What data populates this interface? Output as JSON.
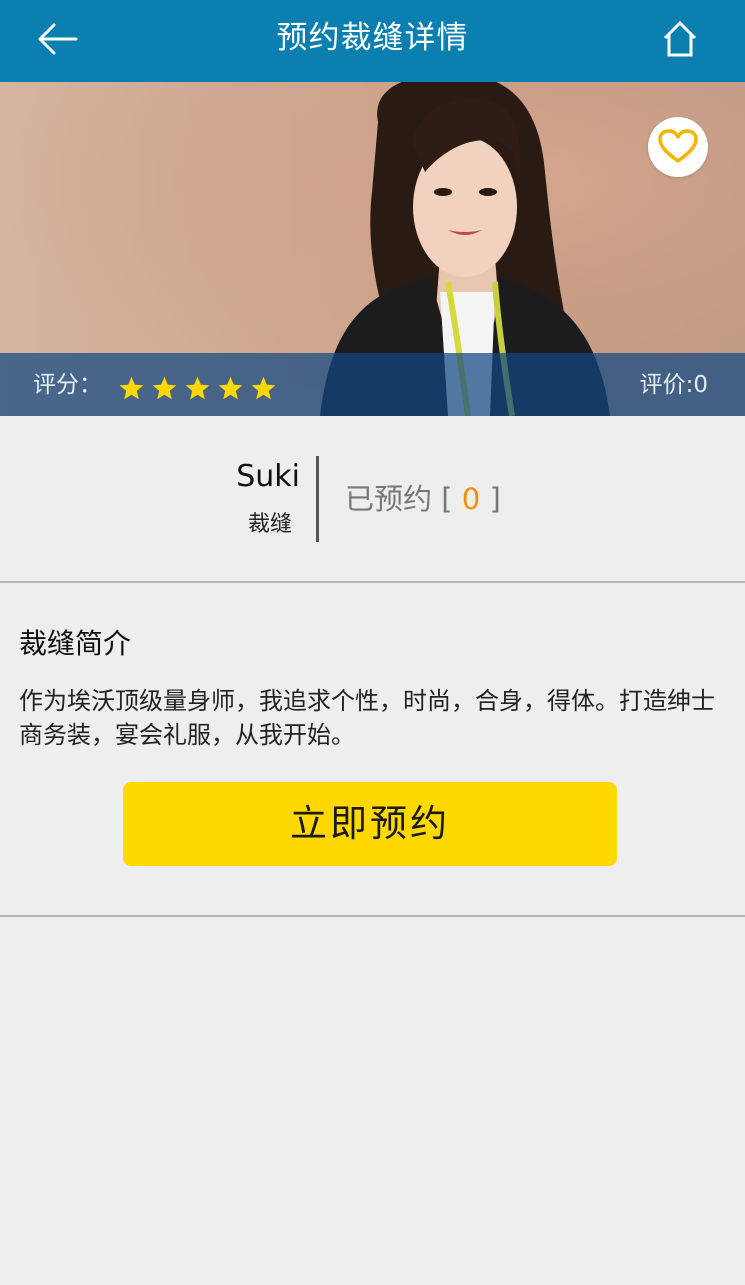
{
  "header": {
    "title": "预约裁缝详情",
    "back_icon": "arrow-left-icon",
    "home_icon": "home-icon"
  },
  "hero": {
    "favorite_icon": "heart-outline-icon",
    "rating_label": "评分：",
    "rating_stars": 5,
    "rating_max": 5,
    "review_count_text": "评价:0"
  },
  "tailor": {
    "name": "Suki",
    "role": "裁缝",
    "booked_label": "已预约",
    "booked_open": "[",
    "booked_count": "0",
    "booked_close": "]"
  },
  "intro": {
    "title": "裁缝简介",
    "text": "作为埃沃顶级量身师，我追求个性，时尚，合身，得体。打造绅士商务装，宴会礼服，从我开始。"
  },
  "actions": {
    "book_now_label": "立即预约"
  },
  "colors": {
    "header_bg": "#0a7fb0",
    "accent_star": "#ffd800",
    "count_orange": "#ff8c00",
    "button_yellow": "#ffd800",
    "heart_gold": "#f4b400"
  }
}
